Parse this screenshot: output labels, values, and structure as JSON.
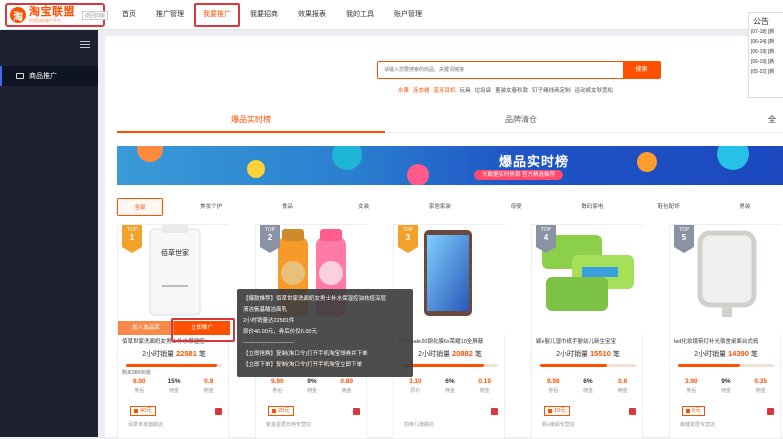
{
  "brand": {
    "name": "淘宝联盟",
    "slogan": "阿里妈妈旗下平台",
    "old_version": "返回旧版",
    "mark": "淘"
  },
  "nav": [
    "首页",
    "推广管理",
    "我要推广",
    "我要招商",
    "效果报表",
    "我的工具",
    "账户管理"
  ],
  "sidebar": {
    "item": "商品推广"
  },
  "search": {
    "placeholder": "请输入您要搜索的商品、关键词链接",
    "button": "搜索"
  },
  "hot_words": [
    "水果",
    "连衣裙",
    "蓝牙耳机",
    "玩具",
    "垃圾袋",
    "董装女春秋款",
    "钉子绳线画定制",
    "运动裤女秋宽松"
  ],
  "tabs": [
    "爆品实时榜",
    "品牌清仓",
    "全"
  ],
  "banner": {
    "title": "爆品实时榜",
    "subtitle": "大数据实时热销 官方精选推荐"
  },
  "categories": [
    "全部",
    "美妆个护",
    "食品",
    "女装",
    "家居家装",
    "母婴",
    "数码家电",
    "鞋包配饰",
    "男装"
  ],
  "cards": [
    {
      "rank": "TOP",
      "num": "1",
      "title": "佰草世家洗面奶女男士补水保湿控",
      "sales_label": "2小时销量",
      "sales": "22581",
      "unit": "笔",
      "pre": "购买98000张",
      "price": "6.00",
      "rate": "15%",
      "comm": "0.9",
      "l1": "券后",
      "l2": "佣金",
      "l3": "佣金",
      "coupon": "40元",
      "shop": "佰草世家旗舰店",
      "bar": 0.95,
      "img": "佰草世家"
    },
    {
      "rank": "TOP",
      "num": "2",
      "title": "",
      "sales_label": "2小时销量",
      "sales": "",
      "unit": "笔",
      "pre": "",
      "price": "9.90",
      "rate": "9%",
      "comm": "0.89",
      "l1": "券后",
      "l2": "佣金",
      "l3": "佣金",
      "coupon": "20元",
      "shop": "紫金星居日用专营店",
      "bar": 0.8,
      "img": ""
    },
    {
      "rank": "TOP",
      "num": "3",
      "title": "华为mate20钢化膜6x荣耀10全屏蔽",
      "sales_label": "2小时销量",
      "sales": "20882",
      "unit": "笔",
      "pre": "",
      "price": "3.10",
      "rate": "6%",
      "comm": "0.19",
      "l1": "原价",
      "l2": "佣金",
      "l3": "佣金",
      "coupon": "",
      "shop": "柏帝儿旗舰店",
      "bar": 0.85,
      "img": ""
    },
    {
      "rank": "TOP",
      "num": "4",
      "title": "颖e婴儿湿巾纸手婴幼儿新生宝宝",
      "sales_label": "2小时销量",
      "sales": "15510",
      "unit": "笔",
      "pre": "",
      "price": "9.98",
      "rate": "6%",
      "comm": "0.6",
      "l1": "券后",
      "l2": "佣金",
      "l3": "佣金",
      "coupon": "10元",
      "shop": "颖e旗舰专营店",
      "bar": 0.7,
      "img": ""
    },
    {
      "rank": "TOP",
      "num": "5",
      "title": "led化妆镜带灯补光宿舍桌面台式梳",
      "sales_label": "2小时销量",
      "sales": "14390",
      "unit": "笔",
      "pre": "",
      "price": "3.90",
      "rate": "9%",
      "comm": "0.35",
      "l1": "券后",
      "l2": "佣金",
      "l3": "佣金",
      "coupon": "5元",
      "shop": "森健家居专营店",
      "bar": 0.65,
      "img": ""
    }
  ],
  "card_buttons": {
    "add": "加入选品库",
    "promote": "立即推广"
  },
  "tooltip": [
    "【爆款推荐】佰草世家洗面奶女男士补水保湿控油祛痘深层",
    "清洁氨基酸洁面乳",
    "2小时销量达22581件",
    "原价46.00元，券后价仅6.00元",
    "----------------------------",
    "【立即抢购】复制(淘口令)打开手机淘宝领券并下单",
    "【立即下单】复制(淘口令)打开手机淘宝立即下单"
  ],
  "notice": {
    "title": "公告",
    "items": [
      "[07-18] [新",
      "[06-24] [新",
      "[06-19] [新",
      "[06-19] [新",
      "[05-22] [新"
    ]
  },
  "colors": {
    "accent": "#ff5000",
    "highlight": "#d9363e",
    "sidebar": "#1e2230"
  }
}
